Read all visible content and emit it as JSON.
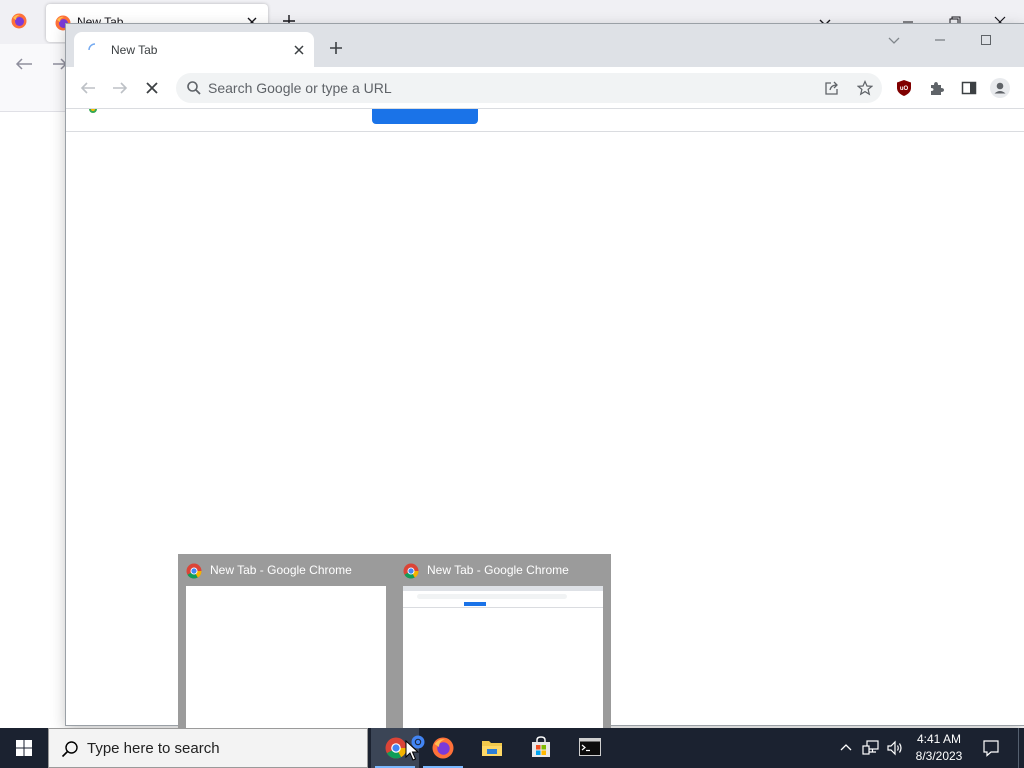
{
  "firefox": {
    "tab_title": "New Tab"
  },
  "chrome": {
    "tab_title": "New Tab",
    "omnibox_placeholder": "Search Google or type a URL"
  },
  "taskbar_preview": {
    "items": [
      {
        "title": "New Tab - Google Chrome"
      },
      {
        "title": "New Tab - Google Chrome"
      }
    ]
  },
  "taskbar": {
    "search_placeholder": "Type here to search",
    "apps": [
      "chrome-icon",
      "chrome-icon",
      "firefox-icon",
      "file-explorer-icon",
      "microsoft-store-icon",
      "terminal-icon"
    ],
    "clock": {
      "time": "4:41 AM",
      "date": "8/3/2023"
    }
  },
  "colors": {
    "chrome_tabstrip": "#dee1e6",
    "chrome_omnibox": "#f1f3f4",
    "accent_blue": "#1a73e8",
    "taskbar": "#1b2230",
    "ublock_red": "#800000"
  }
}
